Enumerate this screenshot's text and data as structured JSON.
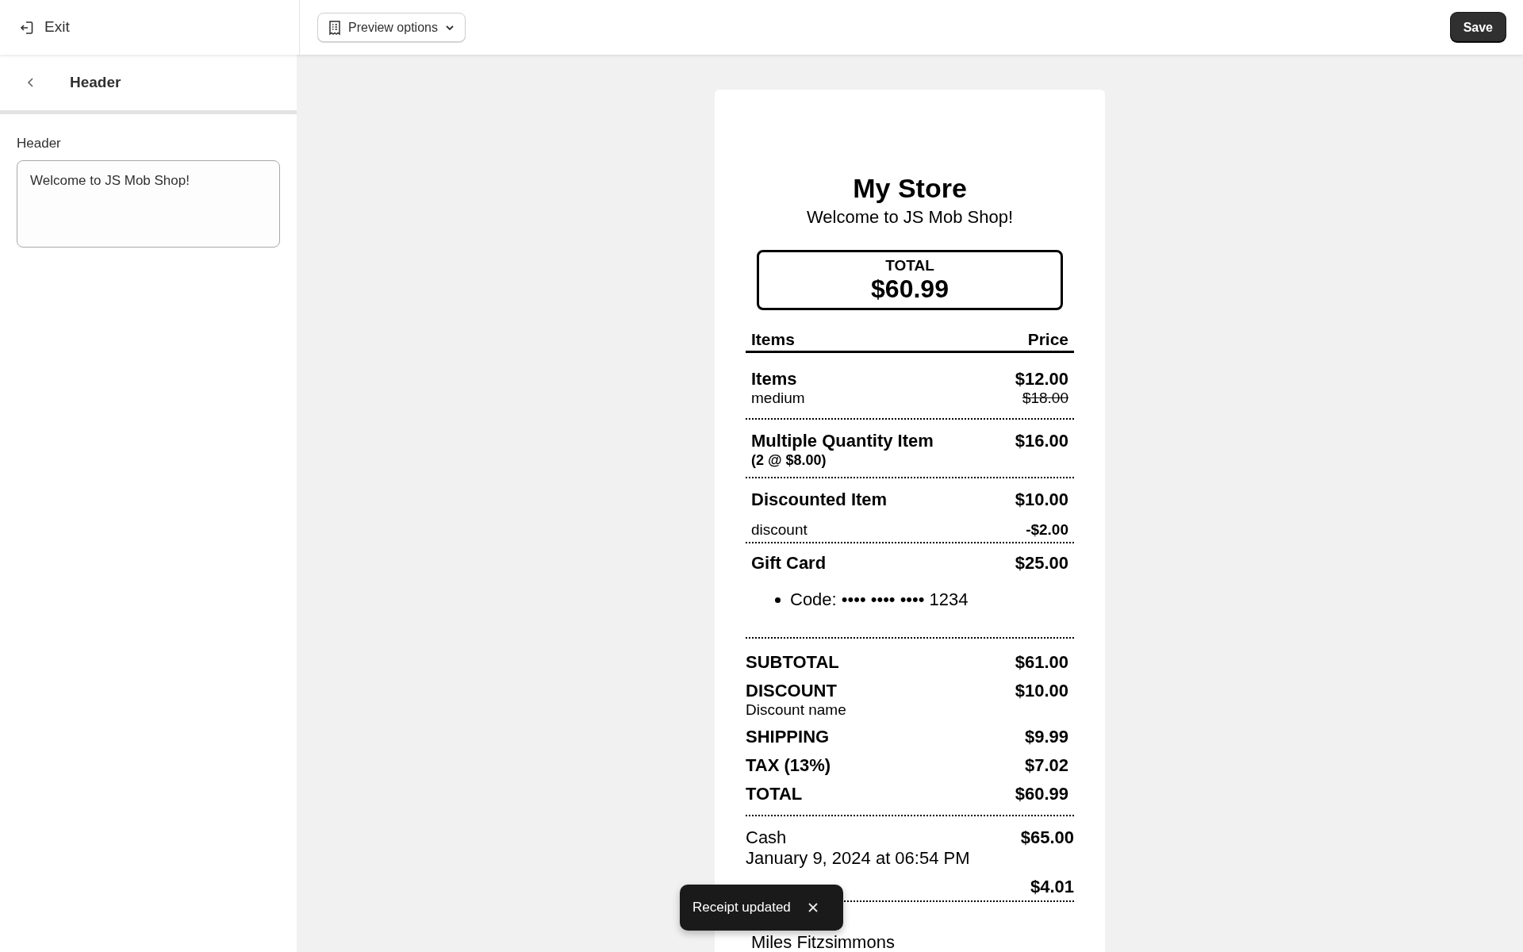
{
  "topbar": {
    "exit": "Exit",
    "preview_button": "Preview options",
    "save_button": "Save"
  },
  "sidebar": {
    "title": "Header",
    "field": {
      "label": "Header",
      "value": "Welcome to JS Mob Shop!"
    }
  },
  "receipt": {
    "store_name": "My Store",
    "header": "Welcome to JS Mob Shop!",
    "total_box": {
      "label": "TOTAL",
      "amount": "$60.99"
    },
    "columns": [
      "Items",
      "Price"
    ],
    "line_items": [
      {
        "kind": "variant",
        "name": "Items",
        "detail": "medium",
        "price": "$12.00",
        "original_price": "$18.00"
      },
      {
        "kind": "quantity",
        "name": "Multiple Quantity Item",
        "detail": "(2 @ $8.00)",
        "price": "$16.00"
      },
      {
        "kind": "discounted",
        "name": "Discounted Item",
        "price": "$10.00",
        "discount_label": "discount",
        "discount_amount": "-$2.00"
      },
      {
        "kind": "gift_card",
        "name": "Gift Card",
        "price": "$25.00",
        "code": "Code: •••• •••• •••• 1234"
      }
    ],
    "totals": [
      {
        "label": "SUBTOTAL",
        "amount": "$61.00"
      },
      {
        "label": "DISCOUNT",
        "detail": "Discount name",
        "amount": "$10.00"
      },
      {
        "label": "SHIPPING",
        "amount": "$9.99"
      },
      {
        "label": "TAX (13%)",
        "amount": "$7.02"
      },
      {
        "label": "TOTAL",
        "amount": "$60.99"
      }
    ],
    "payment": {
      "method": "Cash",
      "date": "January 9, 2024 at 06:54 PM",
      "amount": "$65.00"
    },
    "change": {
      "amount": "$4.01"
    },
    "customer": "Miles Fitzsimmons"
  },
  "toast": {
    "message": "Receipt updated"
  }
}
